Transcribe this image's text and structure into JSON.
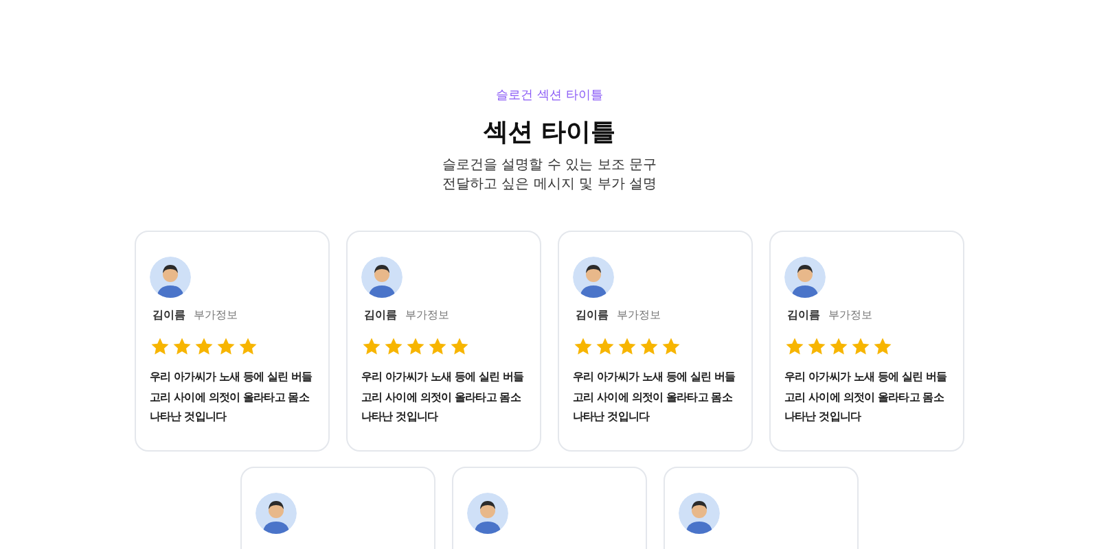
{
  "section": {
    "slogan": "슬로건 섹션 타이틀",
    "title": "섹션 타이틀",
    "subtitle_lines": [
      "슬로건을 설명할 수 있는 보조 문구",
      "전달하고 싶은 메시지 및 부가 설명"
    ]
  },
  "reviews": [
    {
      "avatar": true,
      "name": "김이름",
      "info": "부가정보",
      "stars": 5,
      "text": "우리 아가씨가 노새 등에 실린 버들고리 사이에 의젓이 올라타고 몸소 나타난 것입니다"
    },
    {
      "avatar": true,
      "name": "김이름",
      "info": "부가정보",
      "stars": 5,
      "text": "우리 아가씨가 노새 등에 실린 버들고리 사이에 의젓이 올라타고 몸소 나타난 것입니다"
    },
    {
      "avatar": true,
      "name": "김이름",
      "info": "부가정보",
      "stars": 5,
      "text": "우리 아가씨가 노새 등에 실린 버들고리 사이에 의젓이 올라타고 몸소 나타난 것입니다"
    },
    {
      "avatar": true,
      "name": "김이름",
      "info": "부가정보",
      "stars": 5,
      "text": "우리 아가씨가 노새 등에 실린 버들고리 사이에 의젓이 올라타고 몸소 나타난 것입니다"
    },
    {
      "avatar": true
    },
    {
      "avatar": true
    },
    {
      "avatar": true
    }
  ]
}
